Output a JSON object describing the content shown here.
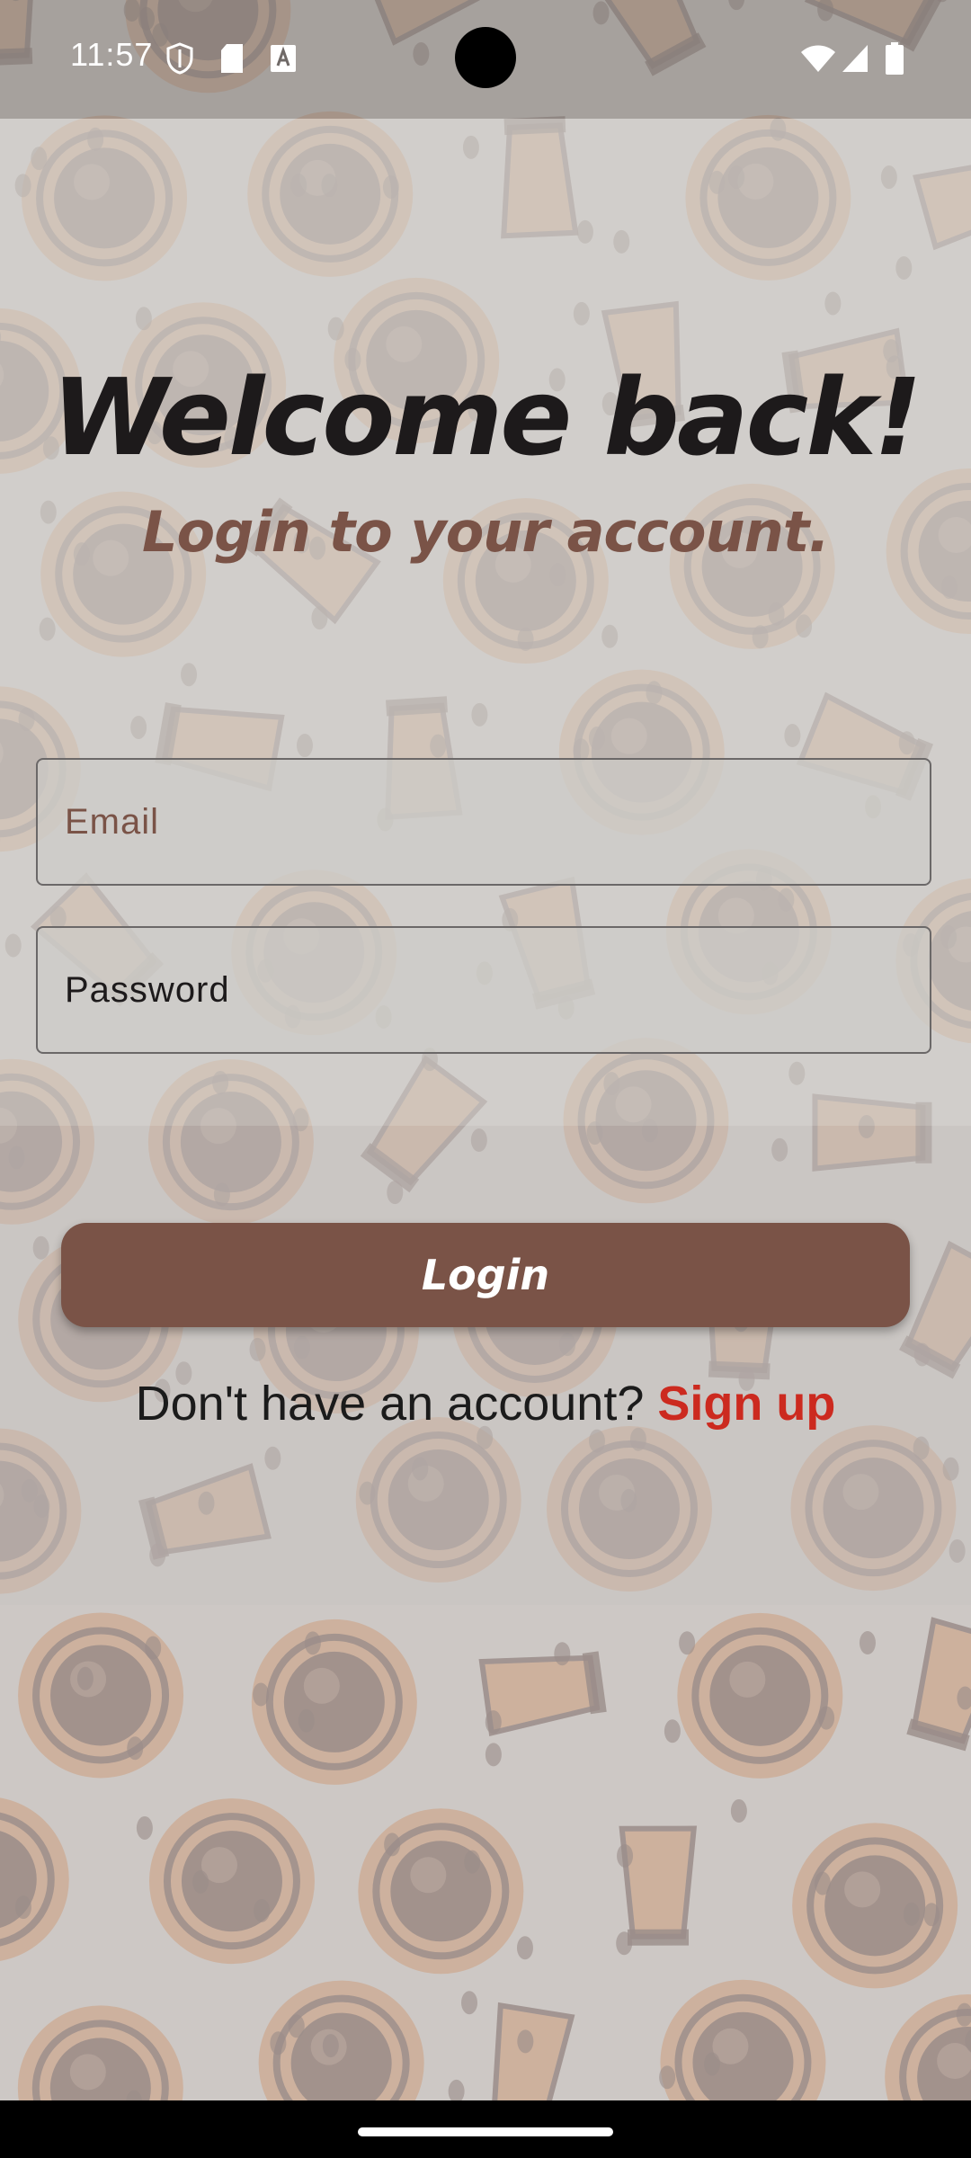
{
  "status_bar": {
    "time": "11:57",
    "left_icons": [
      "shield-icon",
      "sd-card-icon",
      "keyboard-a-icon"
    ],
    "right_icons": [
      "wifi-icon",
      "cell-signal-icon",
      "battery-icon"
    ]
  },
  "header": {
    "title": "Welcome back!",
    "subtitle": "Login to your account."
  },
  "form": {
    "email_placeholder": "Email",
    "email_value": "",
    "password_placeholder": "Password",
    "password_value": ""
  },
  "actions": {
    "login_label": "Login",
    "signup_prompt": "Don't have an account?",
    "signup_link": "Sign up"
  },
  "colors": {
    "brand_brown": "#7a5347",
    "signup_red": "#cc2a1f",
    "title_dark": "#1d1a1b"
  }
}
